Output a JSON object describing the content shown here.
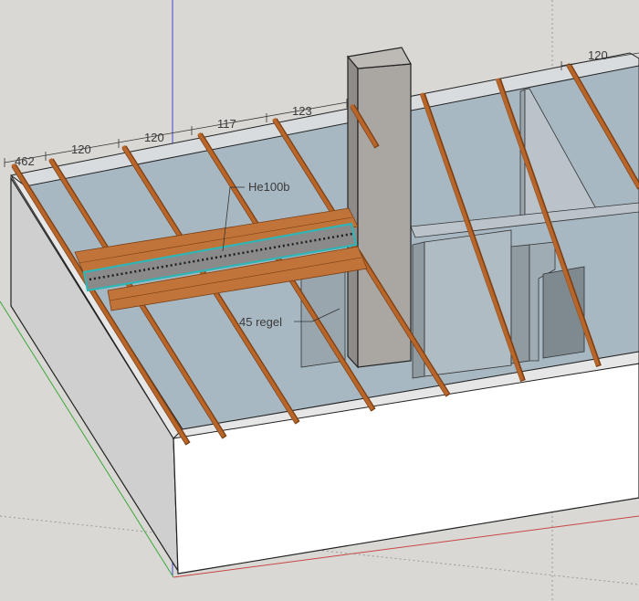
{
  "viewport": {
    "background": "#d9d8d4"
  },
  "dimensions": {
    "top_row": [
      "462",
      "120",
      "120",
      "117",
      "123"
    ],
    "right": "120"
  },
  "labels": {
    "beam": "He100b",
    "stud": "45 regel"
  },
  "colors": {
    "joist": "#b8652a",
    "joist_edge": "#7a3f14",
    "deck_plank": "#c0743a",
    "steel_beam": "#8a8a8a",
    "selection": "#2fb5b5",
    "slab": "#a8b8c2",
    "wall_inner": "#a7b3bb",
    "wall_face": "#ffffff",
    "wall_side": "#cfcfcf",
    "chimney": "#aaa6a2",
    "axis_blue": "#4646c8",
    "axis_green": "#3ca83c",
    "axis_red": "#c84646"
  }
}
